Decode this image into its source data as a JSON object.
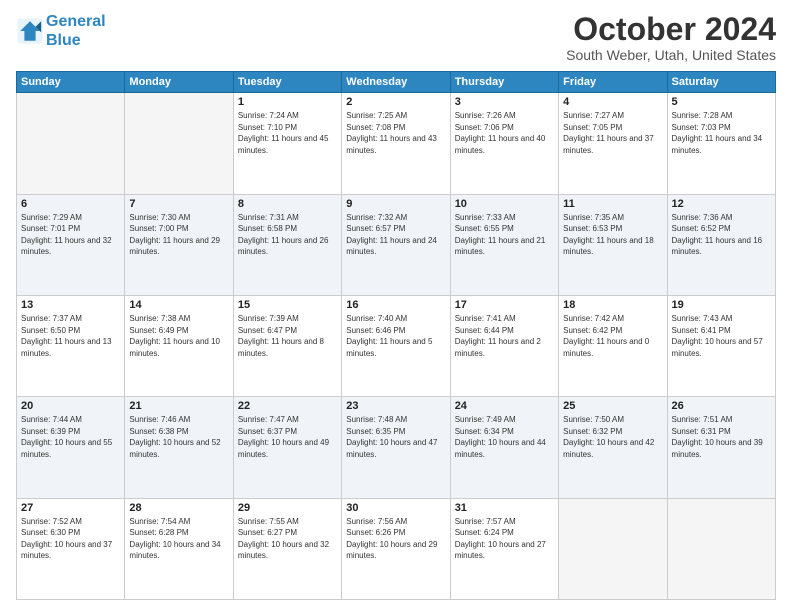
{
  "header": {
    "logo_line1": "General",
    "logo_line2": "Blue",
    "month": "October 2024",
    "location": "South Weber, Utah, United States"
  },
  "days_of_week": [
    "Sunday",
    "Monday",
    "Tuesday",
    "Wednesday",
    "Thursday",
    "Friday",
    "Saturday"
  ],
  "weeks": [
    [
      {
        "day": "",
        "empty": true
      },
      {
        "day": "",
        "empty": true
      },
      {
        "day": "1",
        "sunrise": "7:24 AM",
        "sunset": "7:10 PM",
        "daylight": "11 hours and 45 minutes."
      },
      {
        "day": "2",
        "sunrise": "7:25 AM",
        "sunset": "7:08 PM",
        "daylight": "11 hours and 43 minutes."
      },
      {
        "day": "3",
        "sunrise": "7:26 AM",
        "sunset": "7:06 PM",
        "daylight": "11 hours and 40 minutes."
      },
      {
        "day": "4",
        "sunrise": "7:27 AM",
        "sunset": "7:05 PM",
        "daylight": "11 hours and 37 minutes."
      },
      {
        "day": "5",
        "sunrise": "7:28 AM",
        "sunset": "7:03 PM",
        "daylight": "11 hours and 34 minutes."
      }
    ],
    [
      {
        "day": "6",
        "sunrise": "7:29 AM",
        "sunset": "7:01 PM",
        "daylight": "11 hours and 32 minutes."
      },
      {
        "day": "7",
        "sunrise": "7:30 AM",
        "sunset": "7:00 PM",
        "daylight": "11 hours and 29 minutes."
      },
      {
        "day": "8",
        "sunrise": "7:31 AM",
        "sunset": "6:58 PM",
        "daylight": "11 hours and 26 minutes."
      },
      {
        "day": "9",
        "sunrise": "7:32 AM",
        "sunset": "6:57 PM",
        "daylight": "11 hours and 24 minutes."
      },
      {
        "day": "10",
        "sunrise": "7:33 AM",
        "sunset": "6:55 PM",
        "daylight": "11 hours and 21 minutes."
      },
      {
        "day": "11",
        "sunrise": "7:35 AM",
        "sunset": "6:53 PM",
        "daylight": "11 hours and 18 minutes."
      },
      {
        "day": "12",
        "sunrise": "7:36 AM",
        "sunset": "6:52 PM",
        "daylight": "11 hours and 16 minutes."
      }
    ],
    [
      {
        "day": "13",
        "sunrise": "7:37 AM",
        "sunset": "6:50 PM",
        "daylight": "11 hours and 13 minutes."
      },
      {
        "day": "14",
        "sunrise": "7:38 AM",
        "sunset": "6:49 PM",
        "daylight": "11 hours and 10 minutes."
      },
      {
        "day": "15",
        "sunrise": "7:39 AM",
        "sunset": "6:47 PM",
        "daylight": "11 hours and 8 minutes."
      },
      {
        "day": "16",
        "sunrise": "7:40 AM",
        "sunset": "6:46 PM",
        "daylight": "11 hours and 5 minutes."
      },
      {
        "day": "17",
        "sunrise": "7:41 AM",
        "sunset": "6:44 PM",
        "daylight": "11 hours and 2 minutes."
      },
      {
        "day": "18",
        "sunrise": "7:42 AM",
        "sunset": "6:42 PM",
        "daylight": "11 hours and 0 minutes."
      },
      {
        "day": "19",
        "sunrise": "7:43 AM",
        "sunset": "6:41 PM",
        "daylight": "10 hours and 57 minutes."
      }
    ],
    [
      {
        "day": "20",
        "sunrise": "7:44 AM",
        "sunset": "6:39 PM",
        "daylight": "10 hours and 55 minutes."
      },
      {
        "day": "21",
        "sunrise": "7:46 AM",
        "sunset": "6:38 PM",
        "daylight": "10 hours and 52 minutes."
      },
      {
        "day": "22",
        "sunrise": "7:47 AM",
        "sunset": "6:37 PM",
        "daylight": "10 hours and 49 minutes."
      },
      {
        "day": "23",
        "sunrise": "7:48 AM",
        "sunset": "6:35 PM",
        "daylight": "10 hours and 47 minutes."
      },
      {
        "day": "24",
        "sunrise": "7:49 AM",
        "sunset": "6:34 PM",
        "daylight": "10 hours and 44 minutes."
      },
      {
        "day": "25",
        "sunrise": "7:50 AM",
        "sunset": "6:32 PM",
        "daylight": "10 hours and 42 minutes."
      },
      {
        "day": "26",
        "sunrise": "7:51 AM",
        "sunset": "6:31 PM",
        "daylight": "10 hours and 39 minutes."
      }
    ],
    [
      {
        "day": "27",
        "sunrise": "7:52 AM",
        "sunset": "6:30 PM",
        "daylight": "10 hours and 37 minutes."
      },
      {
        "day": "28",
        "sunrise": "7:54 AM",
        "sunset": "6:28 PM",
        "daylight": "10 hours and 34 minutes."
      },
      {
        "day": "29",
        "sunrise": "7:55 AM",
        "sunset": "6:27 PM",
        "daylight": "10 hours and 32 minutes."
      },
      {
        "day": "30",
        "sunrise": "7:56 AM",
        "sunset": "6:26 PM",
        "daylight": "10 hours and 29 minutes."
      },
      {
        "day": "31",
        "sunrise": "7:57 AM",
        "sunset": "6:24 PM",
        "daylight": "10 hours and 27 minutes."
      },
      {
        "day": "",
        "empty": true
      },
      {
        "day": "",
        "empty": true
      }
    ]
  ]
}
